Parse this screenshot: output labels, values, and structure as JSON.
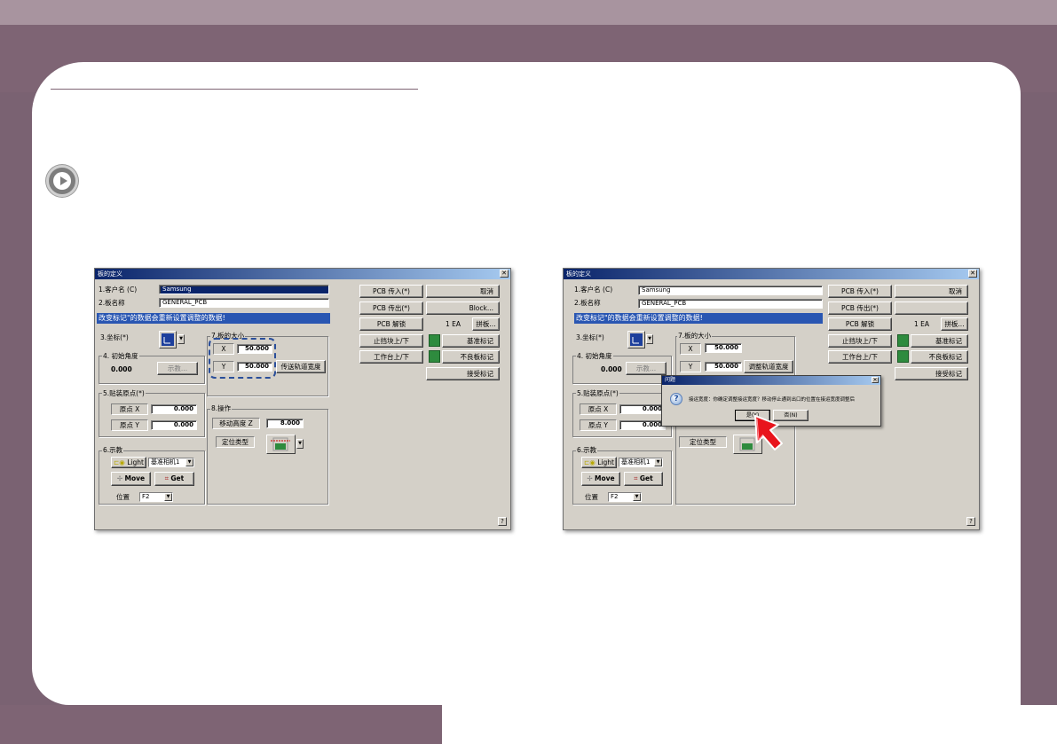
{
  "window_left": {
    "title": "板的定义",
    "customer_label": "1.客户名 (C)",
    "customer_value": "Samsung",
    "board_name_label": "2.板名称",
    "board_name_value": "GENERAL_PCB",
    "banner": "改变标记\"的数据会重新设置调整的数据!",
    "coord_label": "3.坐标(*)",
    "initial_angle_group": "4. 初始角度",
    "initial_angle_value": "0.000",
    "initial_angle_button": "示教...",
    "board_size_group": "7.板的大小",
    "size_x_label": "X",
    "size_x_value": "50.000",
    "size_y_label": "Y",
    "size_y_value": "50.000",
    "conveyor_width_button": "传送轨道宽度",
    "mount_origin_group": "5.贴装原点(*)",
    "origin_x_label": "原点 X",
    "origin_x_value": "0.000",
    "origin_y_label": "原点 Y",
    "origin_y_value": "0.000",
    "operation_group": "8.操作",
    "move_height_label": "移动高度 Z",
    "move_height_value": "8.000",
    "position_type_label": "定位类型",
    "teach_group": "6.示教",
    "light_button": "Light",
    "camera_combo": "基准相机1",
    "move_button": "Move",
    "get_button": "Get",
    "position_label": "位置",
    "position_combo": "F2",
    "pcb_in_button": "PCB 传入(*)",
    "pcb_out_button": "PCB 传出(*)",
    "pcb_unlock_button": "PCB 解锁",
    "stopper_button": "止挡块上/下",
    "table_button": "工作台上/下",
    "cancel_button": "取消",
    "block_button": "Block...",
    "ea_label": "1 EA",
    "panel_button": "拼板...",
    "fiducial_button": "基准标记",
    "bad_mark_button": "不良板标记",
    "accept_mark_button": "接受标记",
    "help_button": "?"
  },
  "window_right": {
    "title": "板的定义",
    "customer_label": "1.客户名 (C)",
    "customer_value": "Samsung",
    "board_name_label": "2.板名称",
    "board_name_value": "GENERAL_PCB",
    "banner": "改变标记\"的数据会重新设置调整的数据!",
    "coord_label": "3.坐标(*)",
    "initial_angle_group": "4. 初始角度",
    "initial_angle_value": "0.000",
    "initial_angle_button": "示教...",
    "board_size_group": "7.板的大小",
    "size_x_label": "X",
    "size_x_value": "50.000",
    "size_y_label": "Y",
    "size_y_value": "50.000",
    "conveyor_width_button": "调整轨道宽度",
    "mount_origin_group": "5.贴装原点(*)",
    "origin_x_label": "原点 X",
    "origin_x_value": "0.000",
    "origin_y_label": "原点 Y",
    "origin_y_value": "0.000",
    "position_type_label": "定位类型",
    "teach_group": "6.示教",
    "light_button": "Light",
    "camera_combo": "基准相机1",
    "move_button": "Move",
    "get_button": "Get",
    "position_label": "位置",
    "position_combo": "F2",
    "pcb_in_button": "PCB 传入(*)",
    "pcb_out_button": "PCB 传出(*)",
    "pcb_unlock_button": "PCB 解锁",
    "stopper_button": "止挡块上/下",
    "table_button": "工作台上/下",
    "cancel_button": "取消",
    "ea_label": "1 EA",
    "panel_button": "拼板...",
    "fiducial_button": "基准标记",
    "bad_mark_button": "不良板标记",
    "accept_mark_button": "接受标记",
    "help_button": "?",
    "dialog": {
      "title": "问题",
      "message": "接运宽度：你确定调整接运宽度？移动停止通到出口的位置在接运宽度调整后",
      "yes_button": "是(Y)",
      "no_button": "否(N)"
    }
  },
  "colors": {
    "accent": "#7e6474",
    "banner": "#2956b2",
    "highlight": "#2a4e9a",
    "cursor": "#e8141c"
  }
}
